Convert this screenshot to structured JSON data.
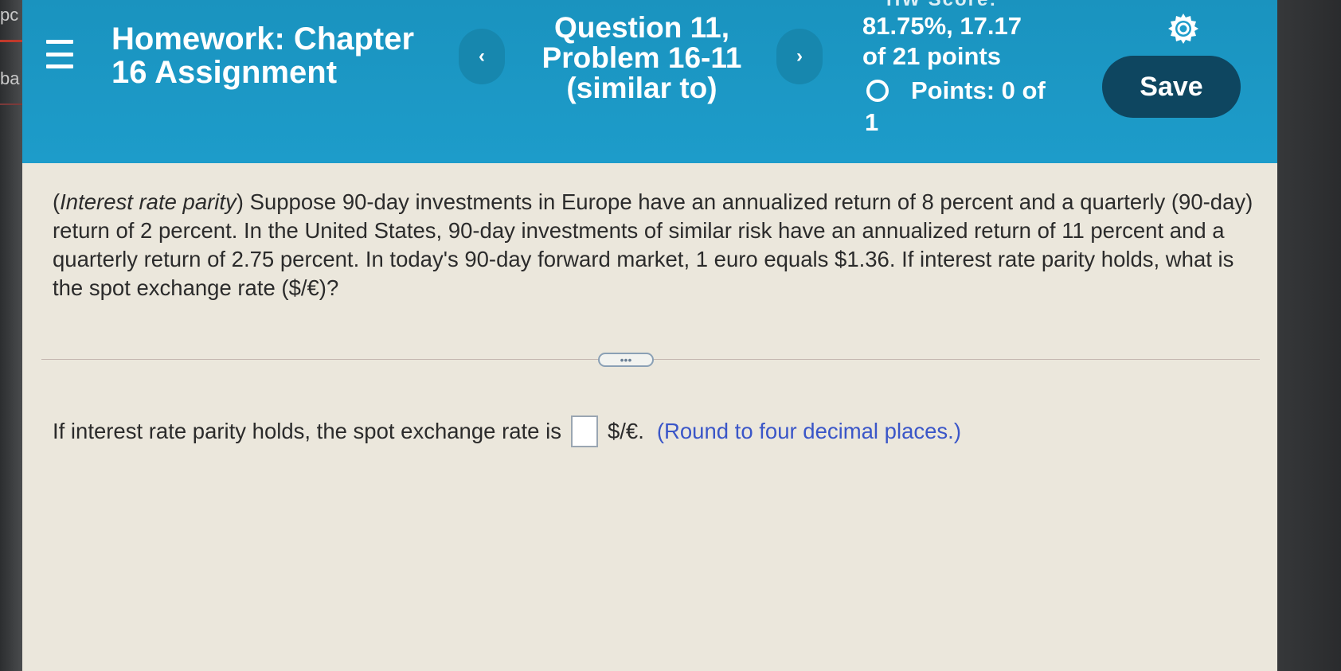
{
  "bezel": {
    "fragment_top": "pc",
    "fragment_bottom": "ba"
  },
  "header": {
    "assignment_title": "Homework: Chapter 16 Assignment",
    "question_title": "Question 11, Problem 16-11 (similar to)",
    "prev_label": "‹",
    "next_label": "›",
    "score_top_partial": "HW Score:",
    "score_line1": "81.75%, 17.17",
    "score_line2": "of 21 points",
    "points_label": "Points: 0 of",
    "points_cont": "1",
    "save_label": "Save"
  },
  "question": {
    "topic": "Interest rate parity",
    "body": " Suppose 90-day investments in Europe have an annualized return of 8 percent and a quarterly (90-day) return of 2 percent. In the United States, 90-day investments of similar risk have an annualized return of 11 percent and a quarterly return of 2.75 percent. In today's 90-day forward market, 1 euro equals $1.36. If interest rate parity holds, what is the spot exchange rate ($/€)?"
  },
  "more_label": "•••",
  "answer": {
    "prefix": "If interest rate parity holds, the spot exchange rate is",
    "value": "",
    "unit": "$/€.",
    "hint": "(Round to four decimal places.)"
  },
  "colors": {
    "header_bg": "#1d9cca",
    "save_bg": "#0e4660",
    "hint_text": "#3a56c8",
    "page_bg": "#ebe7dc"
  }
}
